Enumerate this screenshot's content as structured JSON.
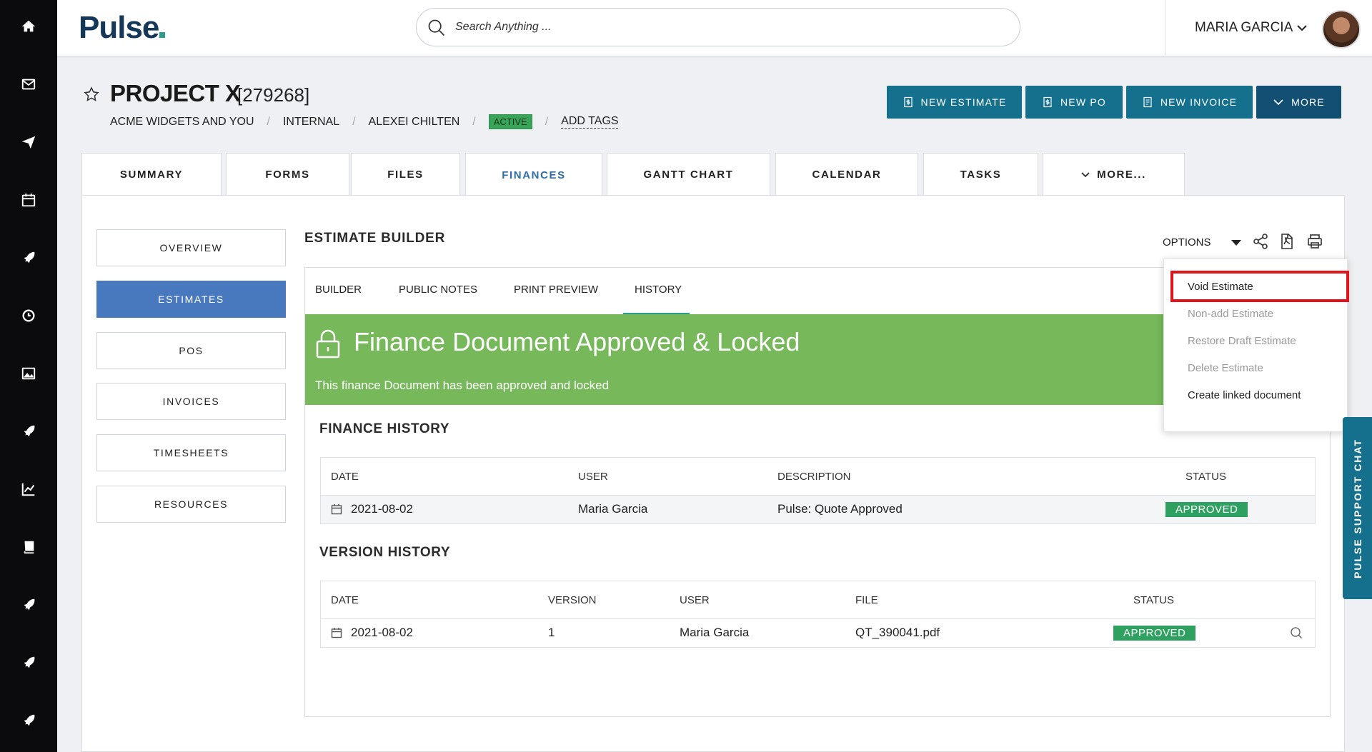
{
  "rail": [
    "home-icon",
    "mail-icon",
    "send-icon",
    "calendar-icon",
    "rocket-icon",
    "clock-icon",
    "image-icon",
    "rocket-icon",
    "chart-icon",
    "book-icon",
    "rocket-icon",
    "rocket-icon",
    "rocket-icon"
  ],
  "header": {
    "logo": "Pulse",
    "search_placeholder": "Search Anything ...",
    "user_name": "MARIA GARCIA"
  },
  "project": {
    "title": "PROJECT X",
    "id": "[279268]",
    "crumbs": [
      "ACME WIDGETS AND YOU",
      "INTERNAL",
      "ALEXEI CHILTEN"
    ],
    "status": "ACTIVE",
    "add_tags": "ADD TAGS"
  },
  "actions": {
    "new_estimate": "NEW ESTIMATE",
    "new_po": "NEW PO",
    "new_invoice": "NEW INVOICE",
    "more": "MORE"
  },
  "tabs": [
    "SUMMARY",
    "FORMS",
    "FILES",
    "FINANCES",
    "GANTT CHART",
    "CALENDAR",
    "TASKS",
    "MORE..."
  ],
  "side_nav": [
    "OVERVIEW",
    "ESTIMATES",
    "POS",
    "INVOICES",
    "TIMESHEETS",
    "RESOURCES"
  ],
  "builder": {
    "title": "ESTIMATE BUILDER",
    "options_label": "OPTIONS",
    "subtabs": [
      "BUILDER",
      "PUBLIC NOTES",
      "PRINT PREVIEW",
      "HISTORY"
    ]
  },
  "banner": {
    "title": "Finance Document Approved & Locked",
    "subtitle": "This finance Document has been approved and locked"
  },
  "finance_history": {
    "title": "FINANCE HISTORY",
    "columns": [
      "DATE",
      "USER",
      "DESCRIPTION",
      "STATUS"
    ],
    "rows": [
      {
        "date": "2021-08-02",
        "user": "Maria Garcia",
        "description": "Pulse: Quote Approved",
        "status": "APPROVED"
      }
    ]
  },
  "version_history": {
    "title": "VERSION HISTORY",
    "columns": [
      "DATE",
      "VERSION",
      "USER",
      "FILE",
      "STATUS"
    ],
    "rows": [
      {
        "date": "2021-08-02",
        "version": "1",
        "user": "Maria Garcia",
        "file": "QT_390041.pdf",
        "status": "APPROVED"
      }
    ]
  },
  "options_menu": [
    {
      "label": "Void Estimate",
      "enabled": true
    },
    {
      "label": "Non-add Estimate",
      "enabled": false
    },
    {
      "label": "Restore Draft Estimate",
      "enabled": false
    },
    {
      "label": "Delete Estimate",
      "enabled": false
    },
    {
      "label": "Create linked document",
      "enabled": true
    }
  ],
  "support_chat": "PULSE SUPPORT CHAT",
  "colors": {
    "primary": "#15708e",
    "active_nav": "#4878bd",
    "banner": "#76b85a",
    "approved": "#2ea161",
    "highlight": "#e0151b"
  }
}
